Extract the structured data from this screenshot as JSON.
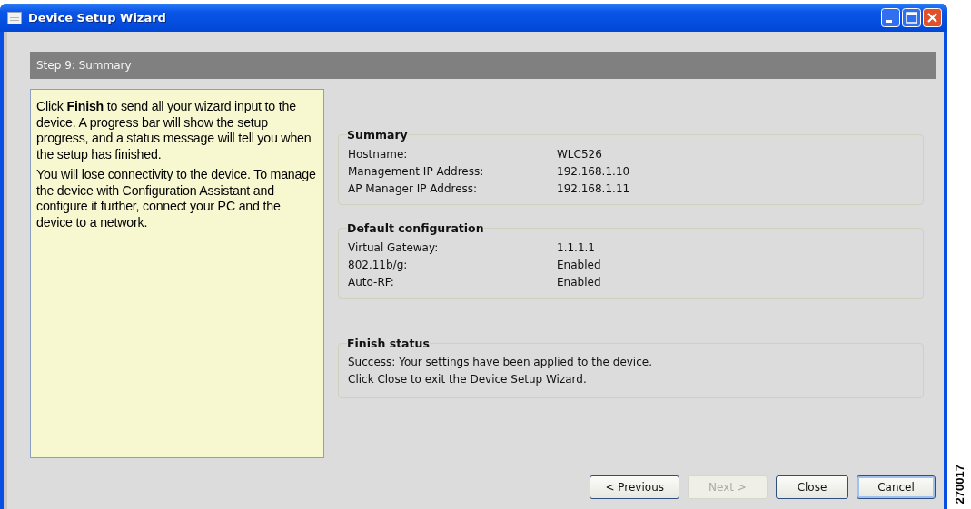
{
  "window": {
    "title": "Device Setup Wizard"
  },
  "step_header": "Step 9: Summary",
  "help_panel": {
    "paragraphs": [
      "Click **Finish** to send all your wizard input to the device. A progress bar will show the setup progress, and a status message will tell you when the setup has finished.",
      "You will lose connectivity to the device. To manage the device with Configuration Assistant and configure it further, connect your PC and the device to a network."
    ]
  },
  "sections": [
    {
      "kind": "fields",
      "title": "Summary",
      "rows": [
        {
          "label": "Hostname:",
          "value": "WLC526"
        },
        {
          "label": "Management IP Address:",
          "value": "192.168.1.10"
        },
        {
          "label": "AP Manager IP Address:",
          "value": "192.168.1.11"
        }
      ]
    },
    {
      "kind": "fields",
      "title": "Default configuration",
      "rows": [
        {
          "label": "Virtual Gateway:",
          "value": "1.1.1.1"
        },
        {
          "label": "802.11b/g:",
          "value": "Enabled"
        },
        {
          "label": "Auto-RF:",
          "value": "Enabled"
        }
      ]
    },
    {
      "kind": "message",
      "title": "Finish status",
      "lines": [
        "Success: Your settings have been applied to the device.",
        "Click Close to exit the Device Setup Wizard."
      ]
    }
  ],
  "buttons": [
    {
      "label": "< Previous",
      "disabled": false,
      "default": false
    },
    {
      "label": "Next >",
      "disabled": true,
      "default": false
    },
    {
      "label": "Close",
      "disabled": false,
      "default": false
    },
    {
      "label": "Cancel",
      "disabled": false,
      "default": true
    }
  ],
  "figure_id": "270017"
}
